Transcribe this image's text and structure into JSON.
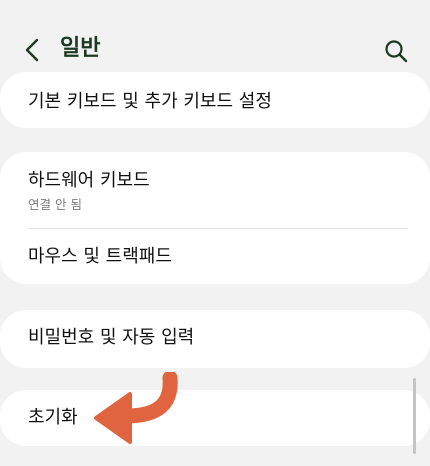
{
  "header": {
    "title": "일반",
    "back_icon": "chevron-left-icon",
    "search_icon": "search-icon"
  },
  "sections": [
    {
      "items": [
        {
          "label": "기본 키보드 및 추가 키보드 설정"
        }
      ]
    },
    {
      "items": [
        {
          "label": "하드웨어 키보드",
          "subtitle": "연결 안 됨"
        },
        {
          "label": "마우스 및 트랙패드"
        }
      ]
    },
    {
      "items": [
        {
          "label": "비밀번호 및 자동 입력"
        }
      ]
    },
    {
      "items": [
        {
          "label": "초기화"
        }
      ]
    }
  ],
  "annotation": {
    "arrow_icon": "curved-arrow-icon",
    "color": "#e0643f"
  },
  "colors": {
    "background": "#f2f2f2",
    "card": "#ffffff",
    "title": "#1c3a22",
    "subtitle": "#7b7b7b"
  }
}
